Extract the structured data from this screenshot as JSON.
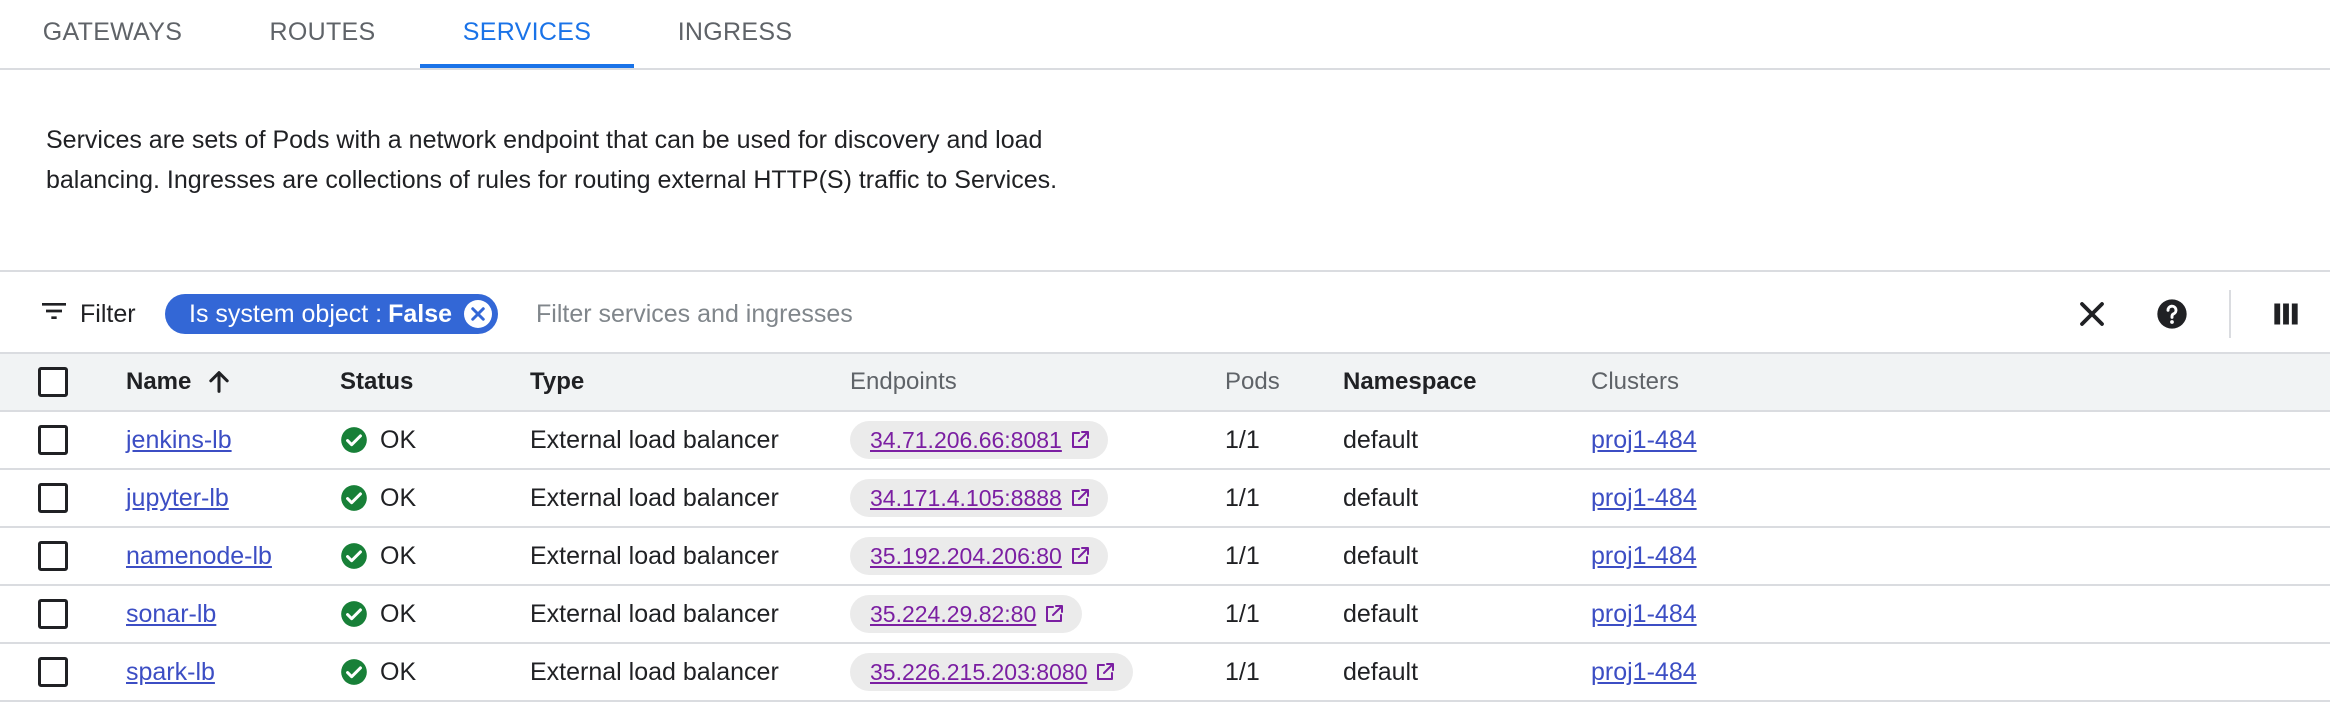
{
  "tabs": [
    {
      "label": "GATEWAYS",
      "active": false
    },
    {
      "label": "ROUTES",
      "active": false
    },
    {
      "label": "SERVICES",
      "active": true
    },
    {
      "label": "INGRESS",
      "active": false
    }
  ],
  "description": "Services are sets of Pods with a network endpoint that can be used for discovery and load balancing. Ingresses are collections of rules for routing external HTTP(S) traffic to Services.",
  "filter": {
    "label": "Filter",
    "chip_key": "Is system object :",
    "chip_value": "False",
    "placeholder": "Filter services and ingresses"
  },
  "table": {
    "columns": {
      "name": "Name",
      "status": "Status",
      "type": "Type",
      "endpoints": "Endpoints",
      "pods": "Pods",
      "namespace": "Namespace",
      "clusters": "Clusters"
    },
    "rows": [
      {
        "name": "jenkins-lb",
        "status": "OK",
        "type": "External load balancer",
        "endpoint": "34.71.206.66:8081",
        "pods": "1/1",
        "namespace": "default",
        "cluster": "proj1-484"
      },
      {
        "name": "jupyter-lb",
        "status": "OK",
        "type": "External load balancer",
        "endpoint": "34.171.4.105:8888",
        "pods": "1/1",
        "namespace": "default",
        "cluster": "proj1-484"
      },
      {
        "name": "namenode-lb",
        "status": "OK",
        "type": "External load balancer",
        "endpoint": "35.192.204.206:80",
        "pods": "1/1",
        "namespace": "default",
        "cluster": "proj1-484"
      },
      {
        "name": "sonar-lb",
        "status": "OK",
        "type": "External load balancer",
        "endpoint": "35.224.29.82:80",
        "pods": "1/1",
        "namespace": "default",
        "cluster": "proj1-484"
      },
      {
        "name": "spark-lb",
        "status": "OK",
        "type": "External load balancer",
        "endpoint": "35.226.215.203:8080",
        "pods": "1/1",
        "namespace": "default",
        "cluster": "proj1-484"
      }
    ]
  },
  "icons": {
    "filter": "filter-list-icon",
    "chip_close": "cancel-icon",
    "clear": "close-icon",
    "help": "help-icon",
    "columns": "column-display-icon",
    "sort": "arrow-upward-icon",
    "status_ok": "check-circle-icon",
    "external_link": "open-in-new-icon"
  },
  "colors": {
    "accent": "#1a73e8",
    "chip": "#3367d6",
    "ok": "#188038",
    "link": "#3c4ec4",
    "endpoint_link": "#7b1fa2"
  }
}
